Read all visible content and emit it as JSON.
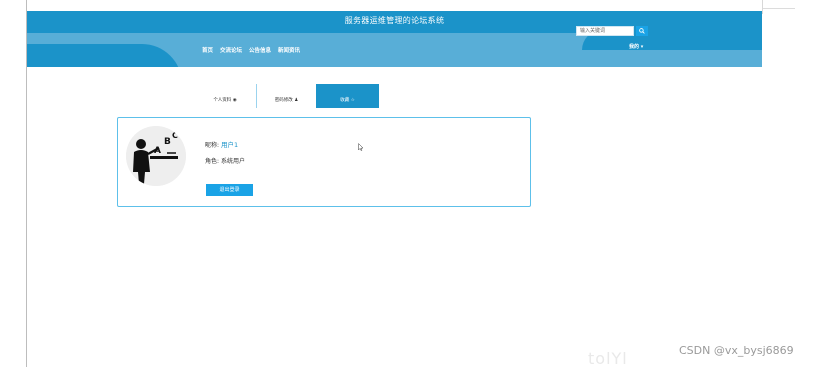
{
  "header": {
    "site_title": "服务器运维管理的论坛系统",
    "nav": [
      "首页",
      "交流论坛",
      "公告信息",
      "新闻资讯"
    ],
    "search_placeholder": "输入关键词",
    "search_icon": "magnifier-icon",
    "mine_label": "我的 ▾"
  },
  "tabs": [
    {
      "label": "个人资料 ◉",
      "active": false
    },
    {
      "label": "密码修改 ♟",
      "active": false
    },
    {
      "label": "收藏 ☆",
      "active": true
    }
  ],
  "profile": {
    "nickname_label": "昵称:",
    "nickname_value": "用户1",
    "role_label": "角色:",
    "role_value": "系统用户",
    "logout_label": "退出登录",
    "avatar_icon": "teacher-at-board-icon"
  },
  "watermark": {
    "faint": "tolYl",
    "credit": "CSDN @vx_bysj6869"
  },
  "colors": {
    "primary": "#1b93c9",
    "band": "#58aed7",
    "button": "#1aa3e6",
    "card_border": "#5dc0ea"
  }
}
